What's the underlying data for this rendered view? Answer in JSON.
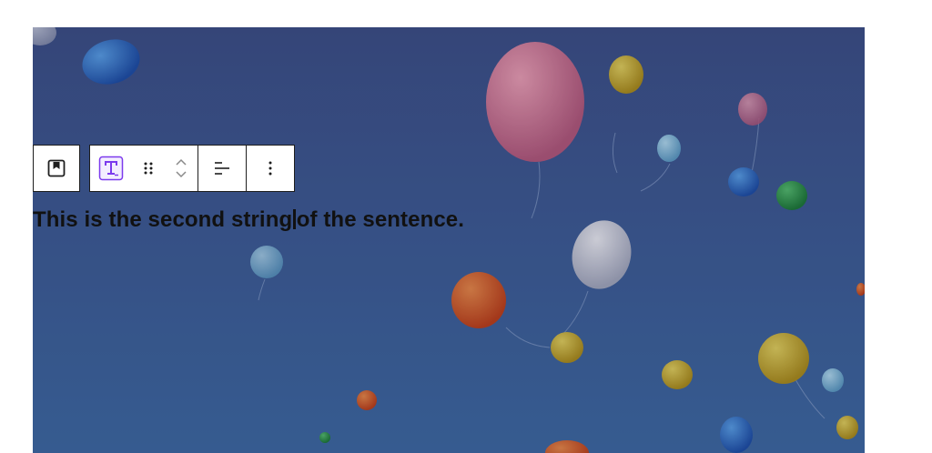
{
  "editor": {
    "block_type": "cover",
    "cover_image": "balloons-in-blue-sky",
    "paragraph": {
      "before_caret": "This is the second string",
      "after_caret": "of the sentence."
    }
  },
  "toolbar": {
    "parent_block_icon": "bookmark-icon",
    "block_type_icon": "paragraph-t-icon",
    "drag_icon": "drag-handle-icon",
    "move_up_icon": "chevron-up-icon",
    "move_down_icon": "chevron-down-icon",
    "align_icon": "align-left-icon",
    "options_icon": "more-vertical-icon",
    "accent_color": "#7c3aed"
  }
}
